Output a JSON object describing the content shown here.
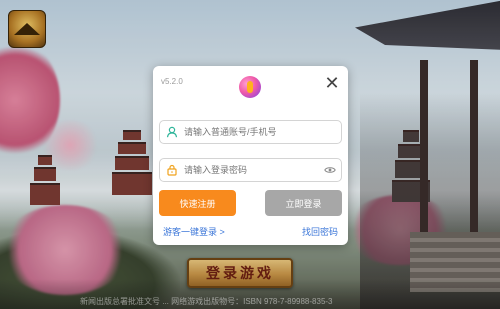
{
  "background": {
    "enter_game_label": "登录游戏",
    "footer_note": "新闻出版总署批准文号 ... 网络游戏出版物号：ISBN 978-7-89988-835-3"
  },
  "dialog": {
    "version": "v5.2.0",
    "close_symbol": "✕",
    "account_placeholder": "请输入普通账号/手机号",
    "password_placeholder": "请输入登录密码",
    "register_label": "快速注册",
    "login_label": "立即登录",
    "guest_login_label": "游客一键登录 >",
    "forgot_password_label": "找回密码"
  },
  "colors": {
    "register_button": "#f88a1d",
    "login_button_disabled": "#a7a7a7",
    "link": "#3b76d8"
  },
  "icons": [
    "game-logo",
    "brand-icon",
    "close-icon",
    "user-icon",
    "lock-icon",
    "eye-icon"
  ]
}
